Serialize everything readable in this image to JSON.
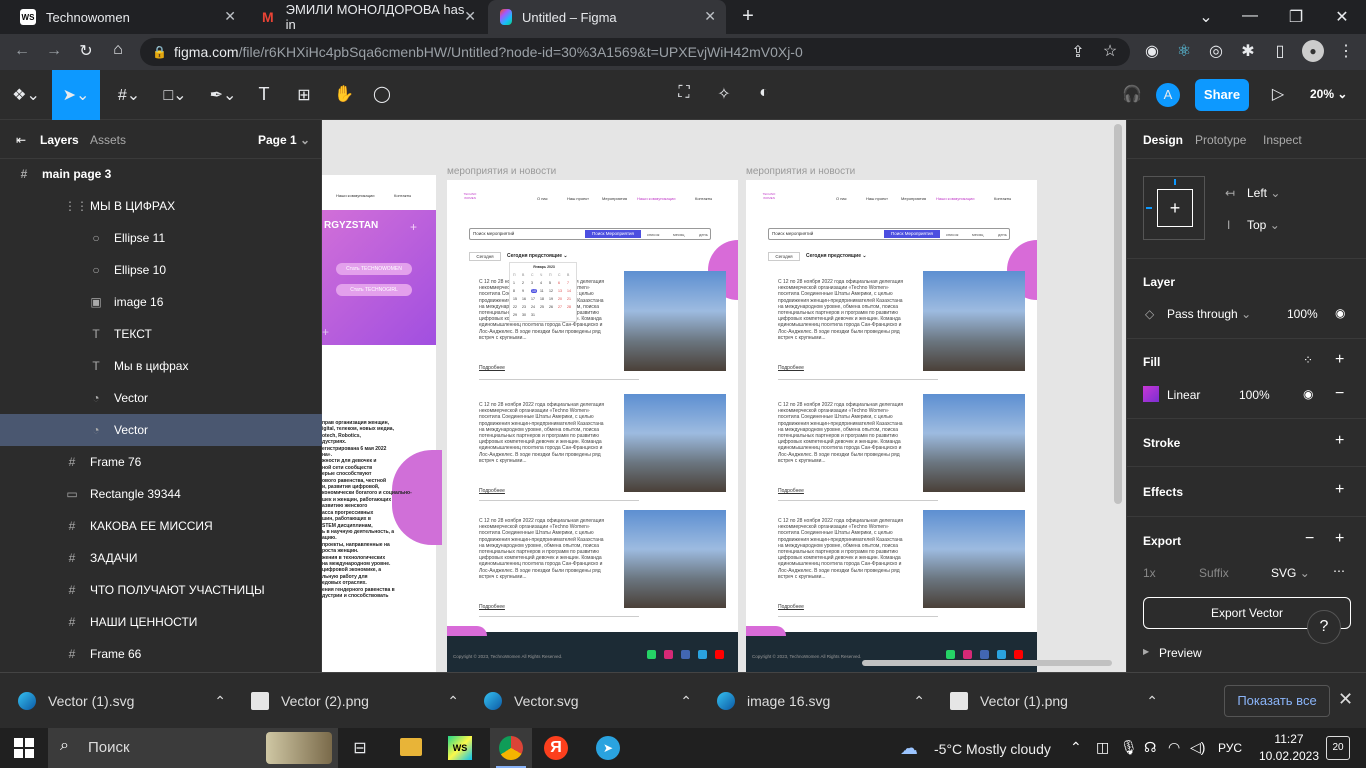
{
  "browser": {
    "tabs": [
      {
        "label": "Technowomen",
        "fav": "WS"
      },
      {
        "label": "ЭМИЛИ МОНОЛДОРОВА has in",
        "fav": "M"
      },
      {
        "label": "Untitled – Figma",
        "fav": "F"
      }
    ],
    "url_host": "figma.com",
    "url_path": "/file/r6KHXiHc4pbSqa6cmenbHW/Untitled?node-id=30%3A1569&t=UPXEvjWiH42mV0Xj-0",
    "profile_initial": "A"
  },
  "figma": {
    "share_label": "Share",
    "zoom": "20%",
    "user_initial": "A",
    "left_tabs": {
      "layers": "Layers",
      "assets": "Assets",
      "page": "Page 1"
    },
    "page_frame": "main page 3",
    "layers": [
      {
        "icon": "⋮⋮",
        "name": "МЫ В ЦИФРАХ",
        "indent": 1
      },
      {
        "icon": "○",
        "name": "Ellipse 11",
        "indent": 2
      },
      {
        "icon": "○",
        "name": "Ellipse 10",
        "indent": 2
      },
      {
        "icon": "▣",
        "name": "image 16",
        "indent": 2
      },
      {
        "icon": "T",
        "name": "ТЕКСТ",
        "indent": 2
      },
      {
        "icon": "T",
        "name": "Мы в цифрах",
        "indent": 2
      },
      {
        "icon": "◔",
        "name": "Vector",
        "indent": 2
      },
      {
        "icon": "◔",
        "name": "Vector",
        "indent": 2,
        "selected": true
      },
      {
        "icon": "#",
        "name": "Frame 76",
        "indent": 1
      },
      {
        "icon": "▭",
        "name": "Rectangle 39344",
        "indent": 1
      },
      {
        "icon": "#",
        "name": "КАКОВА ЕЕ МИССИЯ",
        "indent": 1
      },
      {
        "icon": "#",
        "name": "ЗАДАЧИ",
        "indent": 1
      },
      {
        "icon": "#",
        "name": "ЧТО ПОЛУЧАЮТ УЧАСТНИЦЫ",
        "indent": 1
      },
      {
        "icon": "#",
        "name": "НАШИ ЦЕННОСТИ",
        "indent": 1
      },
      {
        "icon": "#",
        "name": "Frame 66",
        "indent": 1
      }
    ],
    "right": {
      "tabs": [
        "Design",
        "Prototype",
        "Inspect"
      ],
      "constraint_h": "Left",
      "constraint_v": "Top",
      "layer_title": "Layer",
      "blend": "Pass through",
      "layer_opacity": "100%",
      "fill_title": "Fill",
      "fill_type": "Linear",
      "fill_opacity": "100%",
      "fill_color": "#c837d6",
      "stroke_title": "Stroke",
      "effects_title": "Effects",
      "export_title": "Export",
      "export_scale": "1x",
      "export_suffix": "Suffix",
      "export_format": "SVG",
      "export_button": "Export Vector",
      "preview": "Preview",
      "help": "?"
    },
    "canvas": {
      "frame_titles": [
        "мероприятия и новости",
        "мероприятия и новости"
      ],
      "left_frame": {
        "title": "RGYZSTAN",
        "btn1": "Стать TECHNOWOMEN",
        "btn2": "Стать TECHNOGIRL",
        "nav": [
          "Наши коммуникации",
          "Контакты"
        ],
        "body": [
          "прав организация женщин,",
          "igital, телеком, новых медиа,",
          "otech, Robotics,",
          "дустриях.",
          "егистрирована 6 мая 2022",
          "на».",
          "жности для девочек и",
          "ной сети сообществ",
          "ерые способствуют",
          "ового равенства, честной",
          "и, развития цифровой,",
          "кономически богатого и социально-",
          "шек и женщин, работающих",
          "азвитию женского",
          "асса прогрессивных",
          "шин, работающих в",
          "STEM дисциплинам,",
          "ь в научную деятельность, а",
          "ацию.",
          "проекты, направленные на",
          "роста женщин.",
          "жения в технологических",
          "на международном уровне.",
          "цифровой экономике, а",
          "льную работу для",
          "едовых отраслях.",
          "ения гендерного равенства в",
          "дустрии и способствовать"
        ]
      },
      "nav": [
        "О нас",
        "Наш проект",
        "Мероприятия",
        "Наши коммуникации",
        "Контакты"
      ],
      "logo": "TECHNO WOMEN",
      "search_placeholder": "Поиск мероприятий",
      "search_btn": "Поиск Мероприятия",
      "filters": [
        "список",
        "месяц",
        "день"
      ],
      "today": "Сегодня",
      "upcoming": "Сегодня предстоящие",
      "calendar_month": "Январь 2023",
      "cal_days": [
        "П",
        "В",
        "С",
        "Ч",
        "П",
        "С",
        "В"
      ],
      "news_text": "С 12 по 28 ноября 2022 года официальная делегация некоммерческой организации «Techno Women» посетила Соединенные Штаты Америки, с целью продвижения женщин-предпринимателей Казахстана на международном уровне, обмена опытом, поиска потенциальных партнеров и программ по развитию цифровых компетенций девочек и женщин. Команда единомышленниц посетила города Сан-Франциско и Лос-Анджелес. В ходе поездки были проведены ряд встреч с крупными...",
      "more": "Подробнее",
      "footer": "Copyright © 2023, TechnoWomen All Rights Reserved."
    }
  },
  "taskbar": {
    "downloads": [
      "Vector (1).svg",
      "Vector (2).png",
      "Vector.svg",
      "image 16.svg",
      "Vector (1).png"
    ],
    "show_all": "Показать все",
    "search": "Поиск",
    "weather": "-5°C  Mostly cloudy",
    "lang": "РУС",
    "time": "11:27",
    "date": "10.02.2023",
    "notif": "20"
  }
}
